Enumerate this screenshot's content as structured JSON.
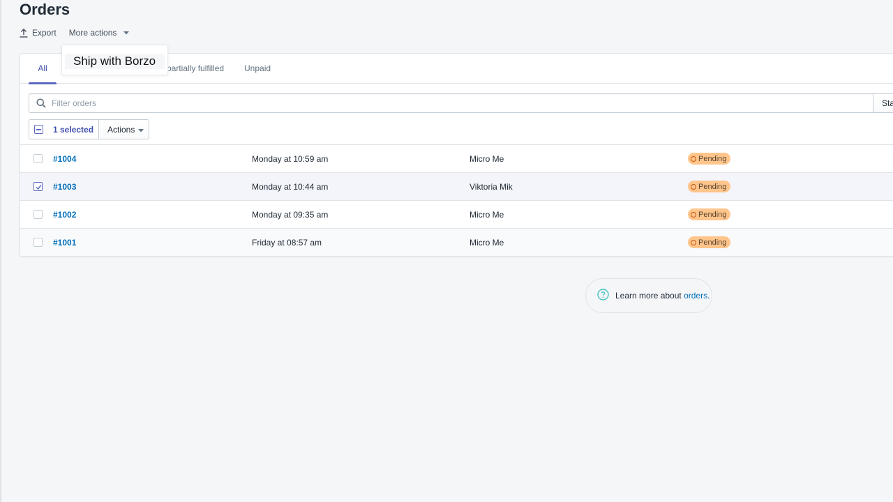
{
  "page": {
    "title": "Orders"
  },
  "secondary_actions": {
    "export_label": "Export",
    "more_actions_label": "More actions"
  },
  "popover": {
    "item_label": "Ship with Borzo"
  },
  "tabs": [
    {
      "label": "All",
      "active": true
    },
    {
      "label": "d partially fulfilled",
      "active": false
    },
    {
      "label": "Unpaid",
      "active": false
    }
  ],
  "filter": {
    "placeholder": "Filter orders",
    "status_label": "Sta"
  },
  "bulk": {
    "selected_label": "1 selected",
    "actions_label": "Actions"
  },
  "orders": [
    {
      "id": "#1004",
      "date": "Monday at 10:59 am",
      "customer": "Micro Me",
      "status": "Pending",
      "checked": false
    },
    {
      "id": "#1003",
      "date": "Monday at 10:44 am",
      "customer": "Viktoria Mik",
      "status": "Pending",
      "checked": true
    },
    {
      "id": "#1002",
      "date": "Monday at 09:35 am",
      "customer": "Micro Me",
      "status": "Pending",
      "checked": false
    },
    {
      "id": "#1001",
      "date": "Friday at 08:57 am",
      "customer": "Micro Me",
      "status": "Pending",
      "checked": false
    }
  ],
  "help": {
    "prefix": "Learn more about ",
    "link": "orders",
    "suffix": "."
  },
  "colors": {
    "accent": "#5c6ac4",
    "link": "#006fbb",
    "pending_badge": "#ffc58b",
    "help_icon": "#47c1bf"
  }
}
